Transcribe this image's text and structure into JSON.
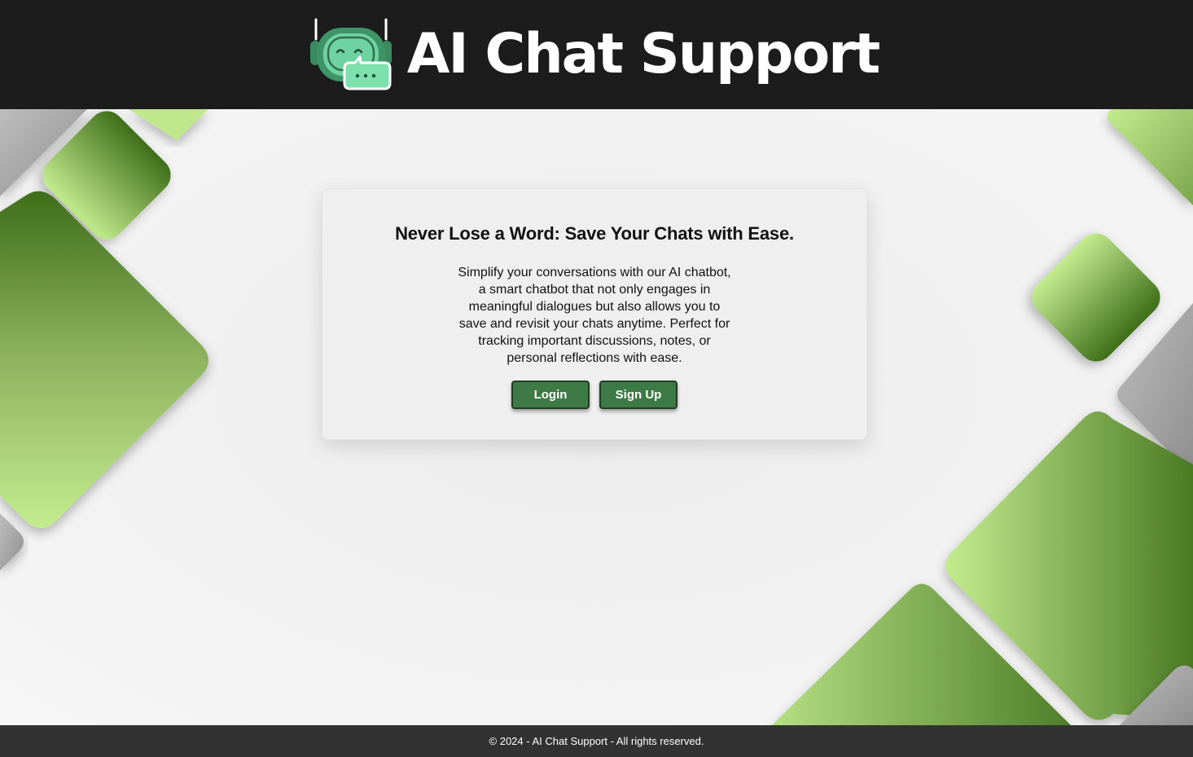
{
  "header": {
    "title": "AI Chat Support",
    "logo_icon": "robot-chat-icon"
  },
  "hero": {
    "title": "Never Lose a Word: Save Your Chats with Ease.",
    "description": "Simplify your conversations with our AI chatbot, a smart chatbot that not only engages in meaningful dialogues but also allows you to save and revisit your chats anytime. Perfect for tracking important discussions, notes, or personal reflections with ease.",
    "login_label": "Login",
    "signup_label": "Sign Up"
  },
  "footer": {
    "text": "© 2024 - AI Chat Support - All rights reserved."
  },
  "colors": {
    "header_bg": "#1c1c1c",
    "footer_bg": "#323232",
    "button_bg": "#3d7a45",
    "accent_green_dark": "#3f6e1a",
    "accent_green_light": "#bde78a",
    "accent_gray": "#9b9b9b"
  }
}
